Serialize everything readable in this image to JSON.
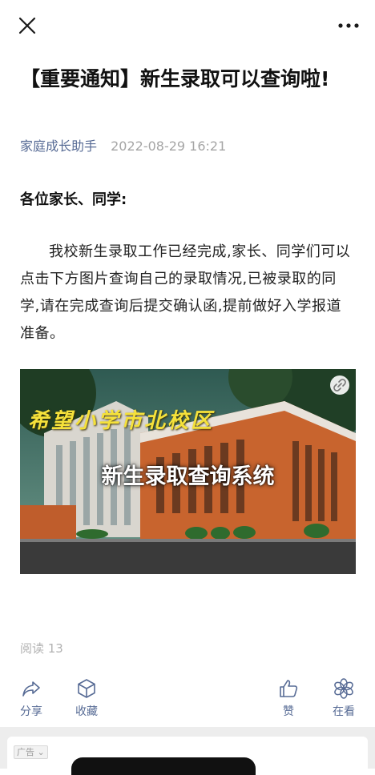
{
  "topbar": {
    "close_icon": "close-icon",
    "more_icon": "more-dots-icon"
  },
  "article": {
    "title": "【重要通知】新生录取可以查询啦!",
    "author": "家庭成长助手",
    "time": "2022-08-29 16:21",
    "greeting": "各位家长、同学:",
    "paragraph": "我校新生录取工作已经完成,家长、同学们可以点击下方图片查询自己的录取情况,已被录取的同学,请在完成查询后提交确认函,提前做好入学报道准备。"
  },
  "banner": {
    "school_name": "希望小学市北校区",
    "system_name": "新生录取查询系统",
    "link_icon": "link-icon"
  },
  "stats": {
    "reads": "阅读 13"
  },
  "actions": {
    "share": {
      "label": "分享",
      "icon": "share-icon"
    },
    "favorite": {
      "label": "收藏",
      "icon": "cube-icon"
    },
    "like": {
      "label": "赞",
      "icon": "thumbs-up-icon"
    },
    "wow": {
      "label": "在看",
      "icon": "flower-icon"
    }
  },
  "ad": {
    "badge": "广告"
  },
  "colors": {
    "link": "#576b95",
    "muted": "#a5a5a5",
    "school_name": "#f5e13b"
  }
}
